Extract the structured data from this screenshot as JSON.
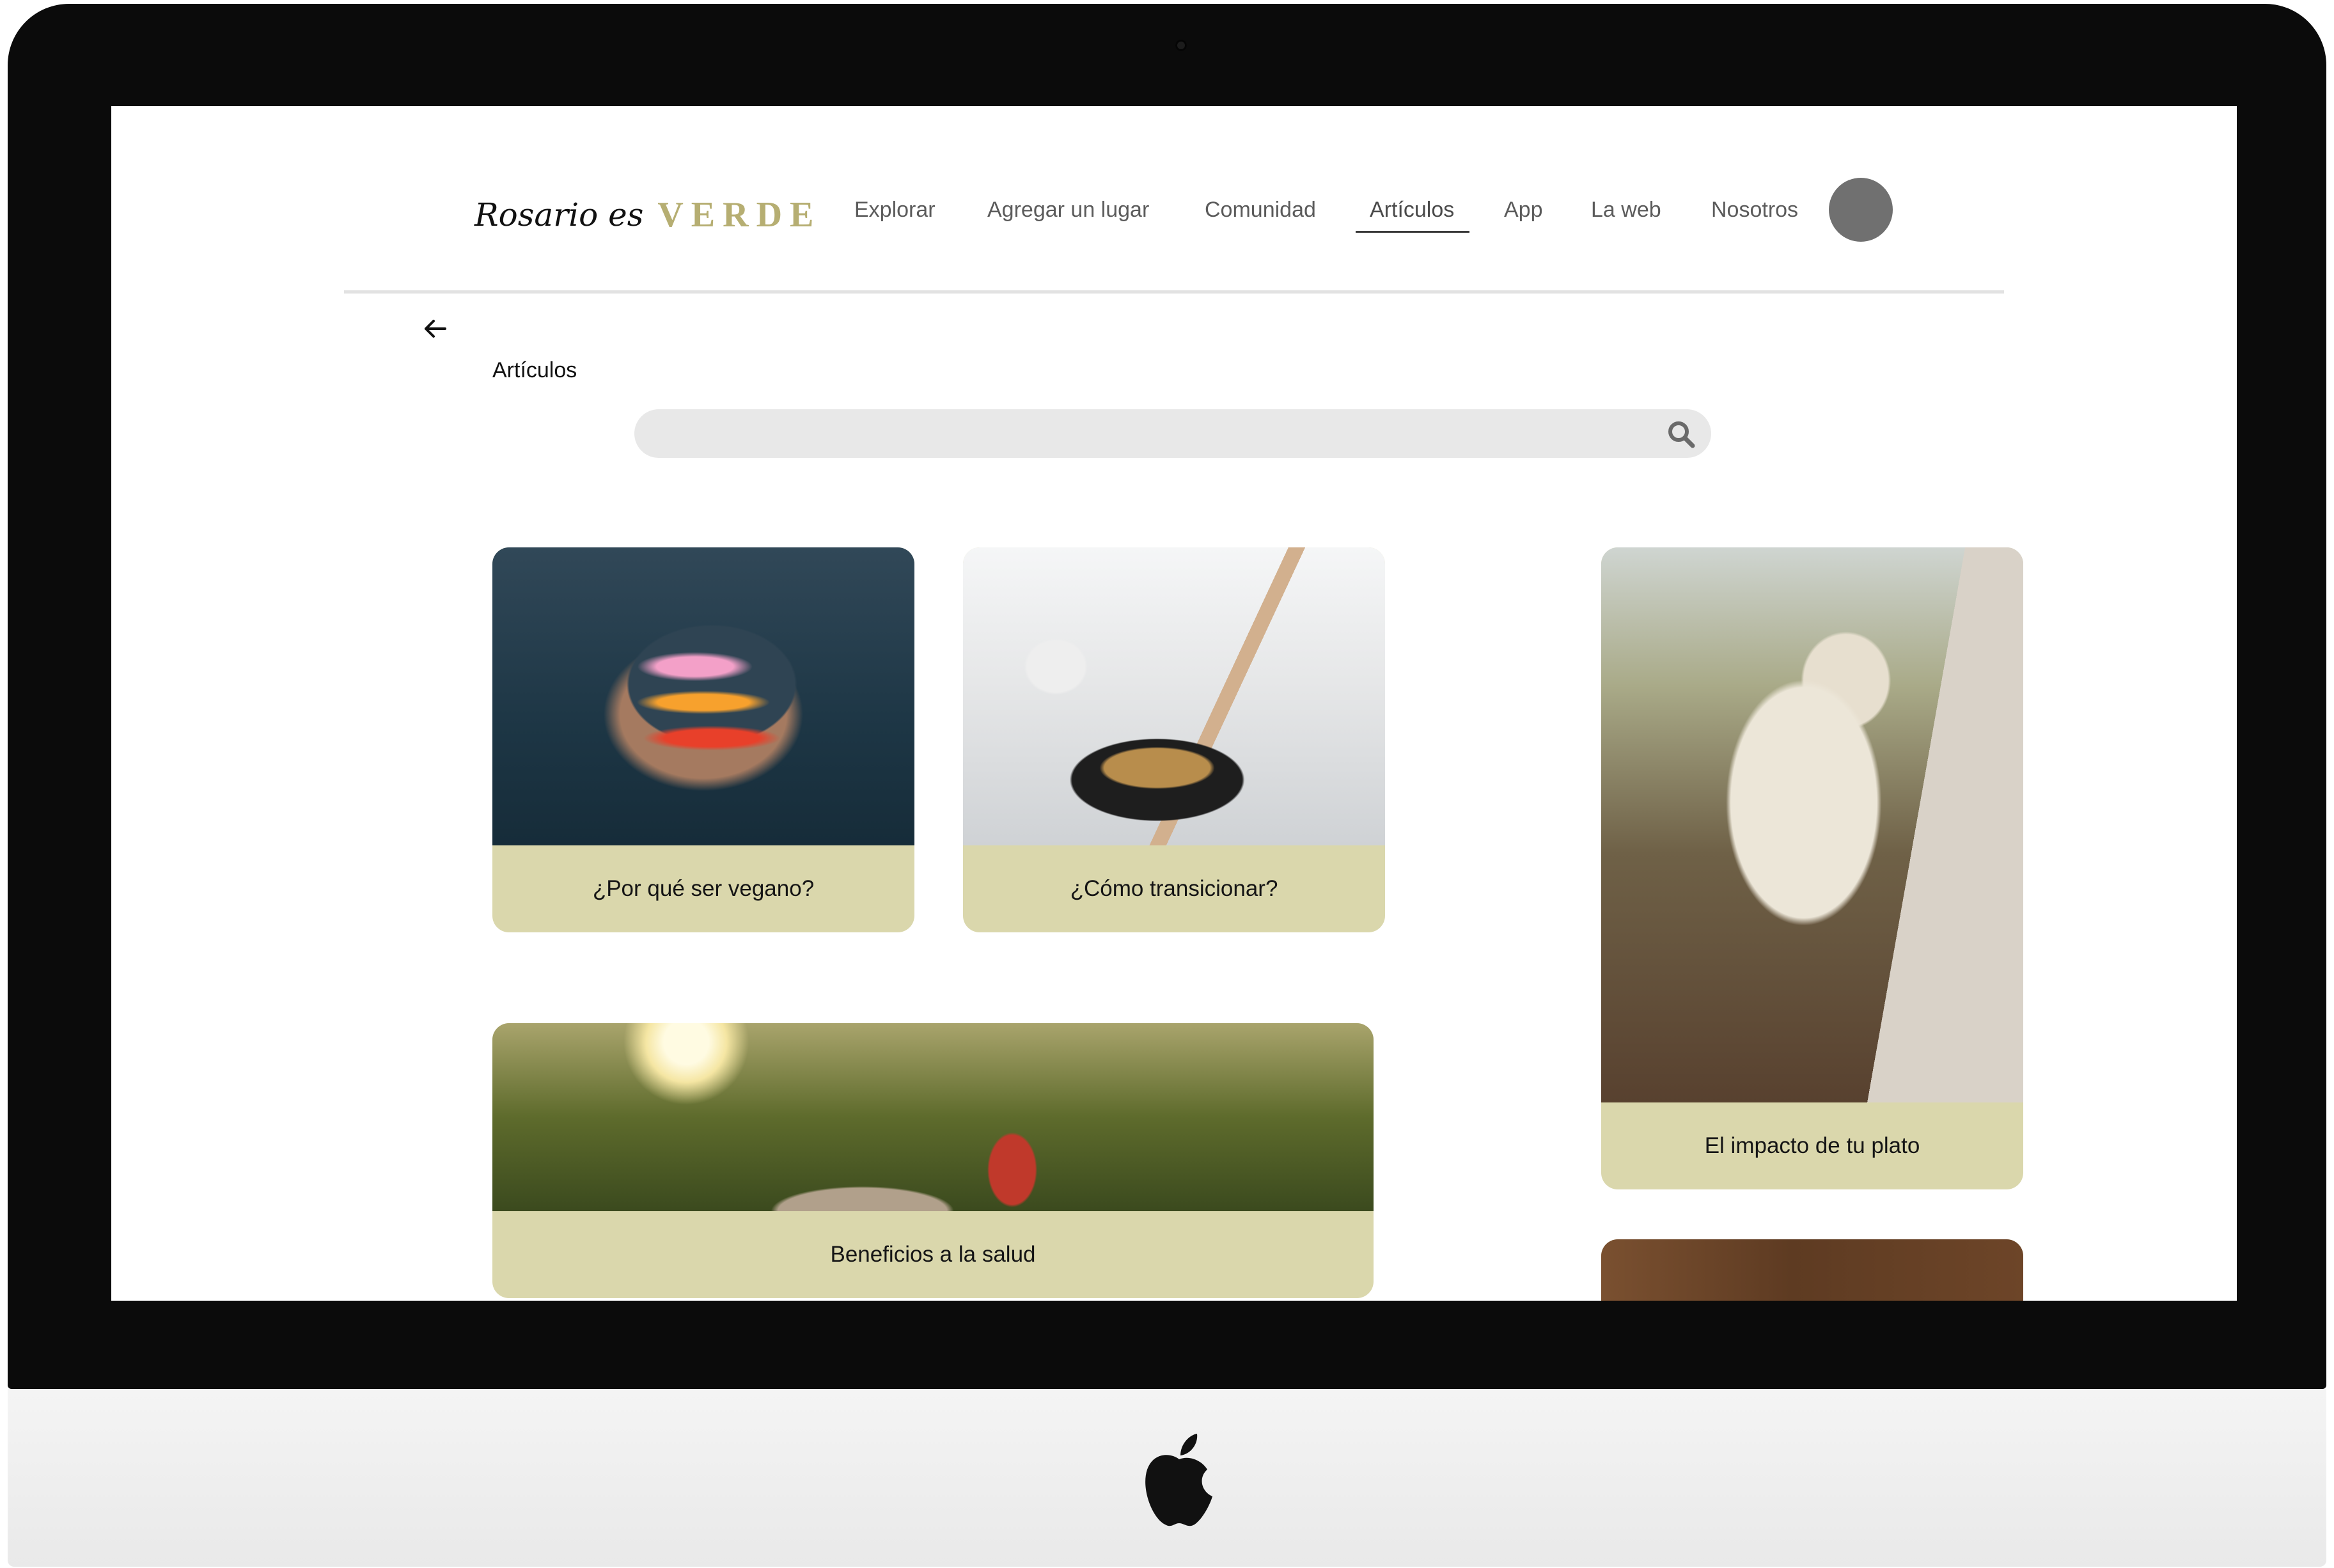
{
  "brand": {
    "name_script": "Rosario es",
    "name_accent": "VERDE"
  },
  "nav": [
    {
      "label": "Explorar"
    },
    {
      "label": "Agregar un lugar"
    },
    {
      "label": "Comunidad"
    },
    {
      "label": "Artículos",
      "active": true
    },
    {
      "label": "App"
    },
    {
      "label": "La web"
    },
    {
      "label": "Nosotros"
    }
  ],
  "page": {
    "title": "Artículos"
  },
  "search": {
    "placeholder": "",
    "value": ""
  },
  "articles": [
    {
      "title": "¿Por qué ser vegano?",
      "image": "veggie-burger"
    },
    {
      "title": "¿Cómo transicionar?",
      "image": "cooking-pan"
    },
    {
      "title": "El impacto de tu plato",
      "image": "lamb"
    },
    {
      "title": "Beneficios a la salud",
      "image": "sunlit-path"
    },
    {
      "title": "",
      "image": "wooden-background"
    }
  ],
  "colors": {
    "card_caption": "#dad7ac",
    "brand_accent": "#b6ae72",
    "avatar": "#707070",
    "search_bg": "#e8e8e8"
  }
}
